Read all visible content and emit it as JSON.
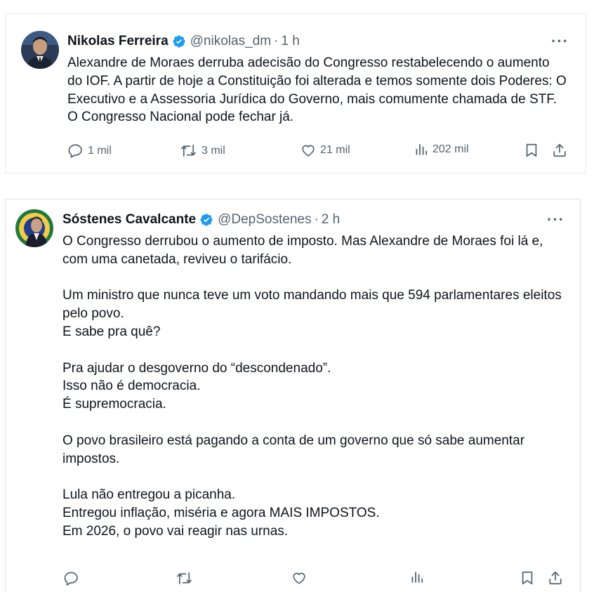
{
  "colors": {
    "text": "#0f1419",
    "secondary": "#536471",
    "verified": "#1d9bf0",
    "border": "#e7eaee"
  },
  "tweets": [
    {
      "author_name": "Nikolas Ferreira",
      "handle": "@nikolas_dm",
      "separator": "·",
      "time": "1 h",
      "more": "···",
      "text": "Alexandre de Moraes derruba adecisão do Congresso restabelecendo o aumento do IOF. A partir de hoje a Constituição foi alterada e temos somente dois Poderes: O Executivo e a Assessoria Jurídica do Governo, mais comumente chamada de STF. O Congresso Nacional pode fechar já.",
      "replies": "1 mil",
      "reposts": "3 mil",
      "likes": "21 mil",
      "views": "202 mil",
      "icons": [
        "reply-icon",
        "repost-icon",
        "like-icon",
        "views-icon",
        "bookmark-icon",
        "share-icon"
      ]
    },
    {
      "author_name": "Sóstenes Cavalcante",
      "handle": "@DepSostenes",
      "separator": "·",
      "time": "2 h",
      "more": "···",
      "text": "O Congresso derrubou o aumento de imposto. Mas Alexandre de Moraes foi lá e, com uma canetada, reviveu o tarifácio.\n\nUm ministro que nunca teve um voto mandando mais que 594 parlamentares eleitos pelo povo.\nE sabe pra quê?\n\nPra ajudar o desgoverno do “descondenado”.\nIsso não é democracia.\nÉ supremocracia.\n\nO povo brasileiro está pagando a conta de um governo que só sabe aumentar impostos.\n\nLula não entregou a picanha.\nEntregou inflação, miséria e agora MAIS IMPOSTOS.\nEm 2026, o povo vai reagir nas urnas.",
      "icons": [
        "reply-icon",
        "repost-icon",
        "like-icon",
        "views-icon",
        "bookmark-icon",
        "share-icon"
      ]
    }
  ]
}
